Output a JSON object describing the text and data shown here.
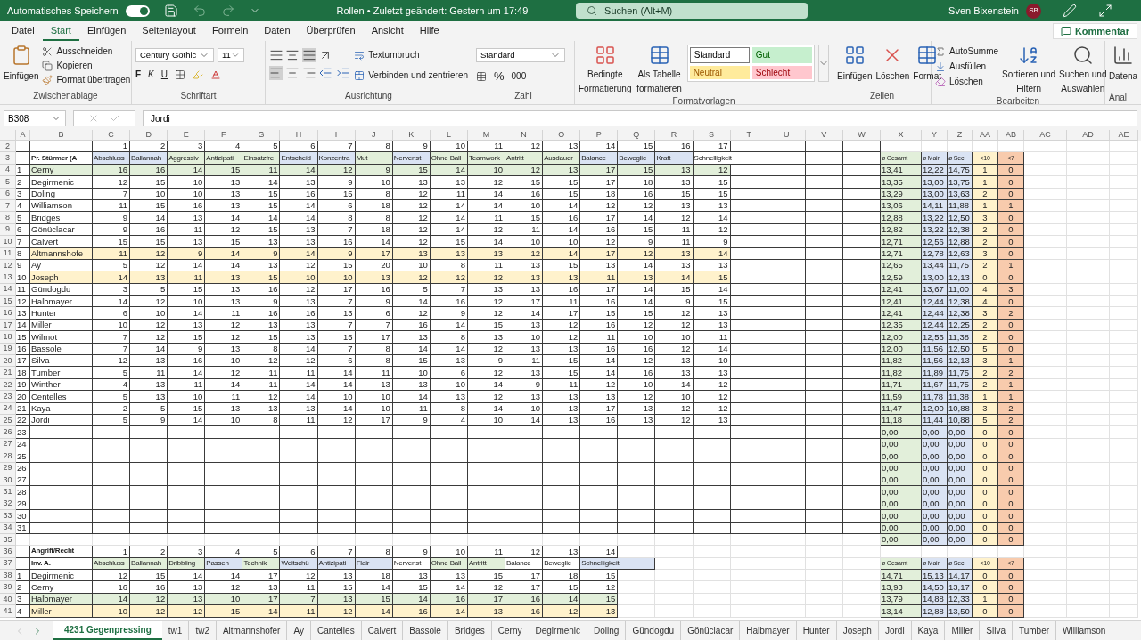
{
  "title_bar": {
    "autosave_label": "Automatisches Speichern",
    "autosave_on": true,
    "document_title": "Rollen • Zuletzt geändert: Gestern um 17:49",
    "search_placeholder": "Suchen (Alt+M)",
    "user_name": "Sven Bixenstein",
    "user_initials": "SB"
  },
  "ribbon_tabs": [
    {
      "label": "Datei",
      "selected": false
    },
    {
      "label": "Start",
      "selected": true
    },
    {
      "label": "Einfügen",
      "selected": false
    },
    {
      "label": "Seitenlayout",
      "selected": false
    },
    {
      "label": "Formeln",
      "selected": false
    },
    {
      "label": "Daten",
      "selected": false
    },
    {
      "label": "Überprüfen",
      "selected": false
    },
    {
      "label": "Ansicht",
      "selected": false
    },
    {
      "label": "Hilfe",
      "selected": false
    }
  ],
  "comment_button": "Kommentar",
  "ribbon": {
    "clipboard": {
      "paste": "Einfügen",
      "cut": "Ausschneiden",
      "copy": "Kopieren",
      "format_painter": "Format übertragen",
      "label": "Zwischenablage"
    },
    "font": {
      "name": "Century Gothic",
      "size": "11",
      "bold": "F",
      "italic": "K",
      "underline": "U",
      "label": "Schriftart"
    },
    "alignment": {
      "wrap": "Textumbruch",
      "merge": "Verbinden und zentrieren",
      "label": "Ausrichtung"
    },
    "number": {
      "format": "Standard",
      "percent": "%",
      "thousands": "000",
      "label": "Zahl"
    },
    "styles": {
      "conditional": [
        "Bedingte",
        "Formatierung"
      ],
      "as_table": [
        "Als Tabelle",
        "formatieren"
      ],
      "cell_styles": [
        {
          "label": "Standard",
          "kind": "standard"
        },
        {
          "label": "Gut",
          "kind": "good"
        },
        {
          "label": "Neutral",
          "kind": "neutral"
        },
        {
          "label": "Schlecht",
          "kind": "bad"
        }
      ],
      "label": "Formatvorlagen"
    },
    "cells": {
      "insert": "Einfügen",
      "delete": "Löschen",
      "format": "Format",
      "label": "Zellen"
    },
    "editing": {
      "autosum": "AutoSumme",
      "fill": "Ausfüllen",
      "clear": "Löschen",
      "sort": [
        "Sortieren und",
        "Filtern"
      ],
      "find": [
        "Suchen und",
        "Auswählen"
      ],
      "label": "Bearbeiten"
    },
    "analysis": {
      "button": "Datena",
      "label": "Anal"
    }
  },
  "formula_bar": {
    "name_box": "B308",
    "formula": "Jordi"
  },
  "sheet": {
    "columns": [
      "A",
      "B",
      "C",
      "D",
      "E",
      "F",
      "G",
      "H",
      "I",
      "J",
      "K",
      "L",
      "M",
      "N",
      "O",
      "P",
      "Q",
      "R",
      "S",
      "T",
      "U",
      "V",
      "W",
      "X",
      "Y",
      "Z",
      "AA",
      "AB",
      "AC",
      "AD",
      "AE"
    ],
    "rows": [
      {
        "row": "2",
        "kind": "numbers",
        "values": [
          "1",
          "2",
          "3",
          "4",
          "5",
          "6",
          "7",
          "8",
          "9",
          "10",
          "11",
          "12",
          "13",
          "14",
          "15",
          "16",
          "17"
        ]
      },
      {
        "row": "3",
        "kind": "header",
        "title": "Pr. Stürmer (A",
        "headers": [
          {
            "label": "Abschluss",
            "color": "#dae3f3"
          },
          {
            "label": "Ballannah",
            "color": "#dae3f3"
          },
          {
            "label": "Aggressiv",
            "color": "#e2efda"
          },
          {
            "label": "Antizipati",
            "color": "#e2efda"
          },
          {
            "label": "Einsatzfre",
            "color": "#e2efda"
          },
          {
            "label": "Entscheid",
            "color": "#dae3f3"
          },
          {
            "label": "Konzentra",
            "color": "#dae3f3"
          },
          {
            "label": "Mut",
            "color": "#e2efda"
          },
          {
            "label": "Nervenst",
            "color": "#dae3f3"
          },
          {
            "label": "Ohne Ball",
            "color": "#e2efda"
          },
          {
            "label": "Teamwork",
            "color": "#e2efda"
          },
          {
            "label": "Antritt",
            "color": "#e2efda"
          },
          {
            "label": "Ausdauer",
            "color": "#e2efda"
          },
          {
            "label": "Balance",
            "color": "#dae3f3"
          },
          {
            "label": "Beweglic",
            "color": "#dae3f3"
          },
          {
            "label": "Kraft",
            "color": "#dae3f3"
          },
          {
            "label": "Schnelligkeit",
            "color": "#ffffff"
          }
        ],
        "stat_headers": [
          "ø Gesamt",
          "ø Main",
          "ø Sec",
          "<10",
          "<7"
        ]
      },
      {
        "row": "4",
        "kind": "player",
        "index": "1",
        "name": "Cerny",
        "color": "#e2efda",
        "values": [
          "16",
          "16",
          "14",
          "15",
          "11",
          "14",
          "12",
          "9",
          "15",
          "14",
          "10",
          "12",
          "13",
          "17",
          "15",
          "13",
          "12"
        ],
        "stats": [
          "13,41",
          "12,22",
          "14,75",
          "1",
          "0"
        ]
      },
      {
        "row": "5",
        "kind": "player",
        "index": "2",
        "name": "Degirmenic",
        "color": "#ffffff",
        "values": [
          "12",
          "15",
          "10",
          "13",
          "14",
          "13",
          "9",
          "10",
          "13",
          "13",
          "12",
          "15",
          "15",
          "17",
          "18",
          "13",
          "15"
        ],
        "stats": [
          "13,35",
          "13,00",
          "13,75",
          "1",
          "0"
        ]
      },
      {
        "row": "6",
        "kind": "player",
        "index": "3",
        "name": "Doling",
        "color": "#ffffff",
        "values": [
          "7",
          "10",
          "10",
          "13",
          "15",
          "16",
          "15",
          "8",
          "12",
          "11",
          "14",
          "16",
          "15",
          "18",
          "16",
          "15",
          "15"
        ],
        "stats": [
          "13,29",
          "13,00",
          "13,63",
          "2",
          "0"
        ]
      },
      {
        "row": "7",
        "kind": "player",
        "index": "4",
        "name": "Williamson",
        "color": "#ffffff",
        "values": [
          "11",
          "15",
          "16",
          "13",
          "15",
          "14",
          "6",
          "18",
          "12",
          "14",
          "14",
          "10",
          "14",
          "12",
          "12",
          "13",
          "13"
        ],
        "stats": [
          "13,06",
          "14,11",
          "11,88",
          "1",
          "1"
        ]
      },
      {
        "row": "8",
        "kind": "player",
        "index": "5",
        "name": "Bridges",
        "color": "#ffffff",
        "values": [
          "9",
          "14",
          "13",
          "14",
          "14",
          "14",
          "8",
          "8",
          "12",
          "14",
          "11",
          "15",
          "16",
          "17",
          "14",
          "12",
          "14"
        ],
        "stats": [
          "12,88",
          "13,22",
          "12,50",
          "3",
          "0"
        ]
      },
      {
        "row": "9",
        "kind": "player",
        "index": "6",
        "name": "Gönüclacar",
        "color": "#ffffff",
        "values": [
          "9",
          "16",
          "11",
          "12",
          "15",
          "13",
          "7",
          "18",
          "12",
          "14",
          "12",
          "11",
          "14",
          "16",
          "15",
          "11",
          "12"
        ],
        "stats": [
          "12,82",
          "13,22",
          "12,38",
          "2",
          "0"
        ]
      },
      {
        "row": "10",
        "kind": "player",
        "index": "7",
        "name": "Calvert",
        "color": "#ffffff",
        "values": [
          "15",
          "15",
          "13",
          "15",
          "13",
          "13",
          "16",
          "14",
          "12",
          "15",
          "14",
          "10",
          "10",
          "12",
          "9",
          "11",
          "9"
        ],
        "stats": [
          "12,71",
          "12,56",
          "12,88",
          "2",
          "0"
        ]
      },
      {
        "row": "11",
        "kind": "player",
        "index": "8",
        "name": "Altmannshofe",
        "color": "#fff2cc",
        "values": [
          "11",
          "12",
          "9",
          "14",
          "9",
          "14",
          "9",
          "17",
          "13",
          "13",
          "13",
          "12",
          "14",
          "17",
          "12",
          "13",
          "14"
        ],
        "stats": [
          "12,71",
          "12,78",
          "12,63",
          "3",
          "0"
        ]
      },
      {
        "row": "12",
        "kind": "player",
        "index": "9",
        "name": "Ay",
        "color": "#ffffff",
        "values": [
          "5",
          "12",
          "14",
          "14",
          "13",
          "12",
          "15",
          "20",
          "10",
          "8",
          "11",
          "13",
          "15",
          "13",
          "14",
          "13",
          "13"
        ],
        "stats": [
          "12,65",
          "13,44",
          "11,75",
          "2",
          "1"
        ]
      },
      {
        "row": "13",
        "kind": "player",
        "index": "10",
        "name": "Joseph",
        "color": "#fff2cc",
        "values": [
          "14",
          "13",
          "11",
          "13",
          "15",
          "10",
          "10",
          "13",
          "12",
          "12",
          "12",
          "13",
          "13",
          "11",
          "13",
          "14",
          "15"
        ],
        "stats": [
          "12,59",
          "13,00",
          "12,13",
          "0",
          "0"
        ]
      },
      {
        "row": "14",
        "kind": "player",
        "index": "11",
        "name": "Gündogdu",
        "color": "#ffffff",
        "values": [
          "3",
          "5",
          "15",
          "13",
          "16",
          "12",
          "17",
          "16",
          "5",
          "7",
          "13",
          "13",
          "16",
          "17",
          "14",
          "15",
          "14"
        ],
        "stats": [
          "12,41",
          "13,67",
          "11,00",
          "4",
          "3"
        ]
      },
      {
        "row": "15",
        "kind": "player",
        "index": "12",
        "name": "Halbmayer",
        "color": "#ffffff",
        "values": [
          "14",
          "12",
          "10",
          "13",
          "9",
          "13",
          "7",
          "9",
          "14",
          "16",
          "12",
          "17",
          "11",
          "16",
          "14",
          "9",
          "15"
        ],
        "stats": [
          "12,41",
          "12,44",
          "12,38",
          "4",
          "0"
        ]
      },
      {
        "row": "16",
        "kind": "player",
        "index": "13",
        "name": "Hunter",
        "color": "#ffffff",
        "values": [
          "6",
          "10",
          "14",
          "11",
          "16",
          "16",
          "13",
          "6",
          "12",
          "9",
          "12",
          "14",
          "17",
          "15",
          "15",
          "12",
          "13"
        ],
        "stats": [
          "12,41",
          "12,44",
          "12,38",
          "3",
          "2"
        ]
      },
      {
        "row": "17",
        "kind": "player",
        "index": "14",
        "name": "Miller",
        "color": "#ffffff",
        "values": [
          "10",
          "12",
          "13",
          "12",
          "13",
          "13",
          "7",
          "7",
          "16",
          "14",
          "15",
          "13",
          "12",
          "16",
          "12",
          "12",
          "13"
        ],
        "stats": [
          "12,35",
          "12,44",
          "12,25",
          "2",
          "0"
        ]
      },
      {
        "row": "18",
        "kind": "player",
        "index": "15",
        "name": "Wilmot",
        "color": "#ffffff",
        "values": [
          "7",
          "12",
          "15",
          "12",
          "15",
          "13",
          "15",
          "17",
          "13",
          "8",
          "13",
          "10",
          "12",
          "11",
          "10",
          "10",
          "11"
        ],
        "stats": [
          "12,00",
          "12,56",
          "11,38",
          "2",
          "0"
        ]
      },
      {
        "row": "19",
        "kind": "player",
        "index": "16",
        "name": "Bassole",
        "color": "#ffffff",
        "values": [
          "7",
          "14",
          "9",
          "13",
          "8",
          "14",
          "7",
          "8",
          "14",
          "14",
          "12",
          "13",
          "13",
          "16",
          "16",
          "12",
          "14"
        ],
        "stats": [
          "12,00",
          "11,56",
          "12,50",
          "5",
          "0"
        ]
      },
      {
        "row": "20",
        "kind": "player",
        "index": "17",
        "name": "Silva",
        "color": "#ffffff",
        "values": [
          "12",
          "13",
          "16",
          "10",
          "12",
          "12",
          "6",
          "8",
          "15",
          "13",
          "9",
          "11",
          "15",
          "14",
          "12",
          "13",
          "10"
        ],
        "stats": [
          "11,82",
          "11,56",
          "12,13",
          "3",
          "1"
        ]
      },
      {
        "row": "21",
        "kind": "player",
        "index": "18",
        "name": "Tumber",
        "color": "#ffffff",
        "values": [
          "5",
          "11",
          "14",
          "12",
          "11",
          "11",
          "14",
          "11",
          "10",
          "6",
          "12",
          "13",
          "15",
          "14",
          "16",
          "13",
          "13"
        ],
        "stats": [
          "11,82",
          "11,89",
          "11,75",
          "2",
          "2"
        ]
      },
      {
        "row": "22",
        "kind": "player",
        "index": "19",
        "name": "Winther",
        "color": "#ffffff",
        "values": [
          "4",
          "13",
          "11",
          "14",
          "11",
          "14",
          "14",
          "13",
          "13",
          "10",
          "14",
          "9",
          "11",
          "12",
          "10",
          "14",
          "12"
        ],
        "stats": [
          "11,71",
          "11,67",
          "11,75",
          "2",
          "1"
        ]
      },
      {
        "row": "23",
        "kind": "player",
        "index": "20",
        "name": "Centelles",
        "color": "#ffffff",
        "values": [
          "5",
          "13",
          "10",
          "11",
          "12",
          "14",
          "10",
          "10",
          "14",
          "13",
          "12",
          "13",
          "13",
          "13",
          "12",
          "10",
          "12"
        ],
        "stats": [
          "11,59",
          "11,78",
          "11,38",
          "1",
          "1"
        ]
      },
      {
        "row": "24",
        "kind": "player",
        "index": "21",
        "name": "Kaya",
        "color": "#ffffff",
        "values": [
          "2",
          "5",
          "15",
          "13",
          "13",
          "13",
          "14",
          "10",
          "11",
          "8",
          "14",
          "10",
          "13",
          "17",
          "13",
          "12",
          "12"
        ],
        "stats": [
          "11,47",
          "12,00",
          "10,88",
          "3",
          "2"
        ]
      },
      {
        "row": "25",
        "kind": "player",
        "index": "22",
        "name": "Jordi",
        "color": "#ffffff",
        "values": [
          "5",
          "9",
          "14",
          "10",
          "8",
          "11",
          "12",
          "17",
          "9",
          "4",
          "10",
          "14",
          "13",
          "16",
          "13",
          "12",
          "13"
        ],
        "stats": [
          "11,18",
          "11,44",
          "10,88",
          "5",
          "2"
        ]
      },
      {
        "row": "26",
        "kind": "empty",
        "index": "23",
        "stats": [
          "0,00",
          "0,00",
          "0,00",
          "0",
          "0"
        ]
      },
      {
        "row": "27",
        "kind": "empty",
        "index": "24",
        "stats": [
          "0,00",
          "0,00",
          "0,00",
          "0",
          "0"
        ]
      },
      {
        "row": "28",
        "kind": "empty",
        "index": "25",
        "stats": [
          "0,00",
          "0,00",
          "0,00",
          "0",
          "0"
        ]
      },
      {
        "row": "29",
        "kind": "empty",
        "index": "26",
        "stats": [
          "0,00",
          "0,00",
          "0,00",
          "0",
          "0"
        ]
      },
      {
        "row": "30",
        "kind": "empty",
        "index": "27",
        "stats": [
          "0,00",
          "0,00",
          "0,00",
          "0",
          "0"
        ]
      },
      {
        "row": "31",
        "kind": "empty",
        "index": "28",
        "stats": [
          "0,00",
          "0,00",
          "0,00",
          "0",
          "0"
        ]
      },
      {
        "row": "32",
        "kind": "empty",
        "index": "29",
        "stats": [
          "0,00",
          "0,00",
          "0,00",
          "0",
          "0"
        ]
      },
      {
        "row": "33",
        "kind": "empty",
        "index": "30",
        "stats": [
          "0,00",
          "0,00",
          "0,00",
          "0",
          "0"
        ]
      },
      {
        "row": "34",
        "kind": "empty",
        "index": "31",
        "stats": [
          "0,00",
          "0,00",
          "0,00",
          "0",
          "0"
        ]
      },
      {
        "row": "35",
        "kind": "stats_only",
        "stats": [
          "0,00",
          "0,00",
          "0,00",
          "0",
          "0"
        ]
      },
      {
        "row": "36",
        "kind": "numbers",
        "title": "Angriff/Recht",
        "values": [
          "1",
          "2",
          "3",
          "4",
          "5",
          "6",
          "7",
          "8",
          "9",
          "10",
          "11",
          "12",
          "13",
          "14"
        ]
      },
      {
        "row": "37",
        "kind": "header",
        "title": "Inv. A.",
        "headers": [
          {
            "label": "Abschluss",
            "color": "#e2efda"
          },
          {
            "label": "Ballannah",
            "color": "#e2efda"
          },
          {
            "label": "Dribbling",
            "color": "#e2efda"
          },
          {
            "label": "Passen",
            "color": "#dae3f3"
          },
          {
            "label": "Technik",
            "color": "#e2efda"
          },
          {
            "label": "Weitschü",
            "color": "#dae3f3"
          },
          {
            "label": "Antizipati",
            "color": "#dae3f3"
          },
          {
            "label": "Flair",
            "color": "#dae3f3"
          },
          {
            "label": "Nervenst",
            "color": "#ffffff"
          },
          {
            "label": "Ohne Ball",
            "color": "#e2efda"
          },
          {
            "label": "Antritt",
            "color": "#e2efda"
          },
          {
            "label": "Balance",
            "color": "#ffffff"
          },
          {
            "label": "Beweglic",
            "color": "#ffffff"
          },
          {
            "label": "Schnelligkeit",
            "color": "#dae3f3"
          }
        ],
        "stat_headers": [
          "ø Gesamt",
          "ø Main",
          "ø Sec",
          "<10",
          "<7"
        ]
      },
      {
        "row": "38",
        "kind": "player",
        "index": "1",
        "name": "Degirmenic",
        "color": "#ffffff",
        "values": [
          "12",
          "15",
          "14",
          "14",
          "17",
          "12",
          "13",
          "18",
          "13",
          "13",
          "15",
          "17",
          "18",
          "15"
        ],
        "stats": [
          "14,71",
          "15,13",
          "14,17",
          "0",
          "0"
        ]
      },
      {
        "row": "39",
        "kind": "player",
        "index": "2",
        "name": "Cerny",
        "color": "#ffffff",
        "values": [
          "16",
          "16",
          "13",
          "12",
          "13",
          "11",
          "15",
          "14",
          "15",
          "14",
          "12",
          "17",
          "15",
          "12"
        ],
        "stats": [
          "13,93",
          "14,50",
          "13,17",
          "0",
          "0"
        ]
      },
      {
        "row": "40",
        "kind": "player",
        "index": "3",
        "name": "Halbmayer",
        "color": "#e2efda",
        "values": [
          "14",
          "12",
          "13",
          "10",
          "17",
          "7",
          "13",
          "15",
          "14",
          "16",
          "17",
          "16",
          "14",
          "15"
        ],
        "stats": [
          "13,79",
          "14,88",
          "12,33",
          "1",
          "0"
        ]
      },
      {
        "row": "41",
        "kind": "player",
        "index": "4",
        "name": "Miller",
        "color": "#fff2cc",
        "values": [
          "10",
          "12",
          "12",
          "15",
          "14",
          "11",
          "12",
          "14",
          "16",
          "14",
          "13",
          "16",
          "12",
          "13"
        ],
        "stats": [
          "13,14",
          "12,88",
          "13,50",
          "0",
          "0"
        ]
      }
    ]
  },
  "sheet_tabs": [
    {
      "label": "4231 Gegenpressing",
      "selected": true
    },
    {
      "label": "tw1",
      "selected": false
    },
    {
      "label": "tw2",
      "selected": false
    },
    {
      "label": "Altmannshofer",
      "selected": false
    },
    {
      "label": "Ay",
      "selected": false
    },
    {
      "label": "Cantelles",
      "selected": false
    },
    {
      "label": "Calvert",
      "selected": false
    },
    {
      "label": "Bassole",
      "selected": false
    },
    {
      "label": "Bridges",
      "selected": false
    },
    {
      "label": "Cerny",
      "selected": false
    },
    {
      "label": "Degirmenic",
      "selected": false
    },
    {
      "label": "Doling",
      "selected": false
    },
    {
      "label": "Gündogdu",
      "selected": false
    },
    {
      "label": "Gönüclacar",
      "selected": false
    },
    {
      "label": "Halbmayer",
      "selected": false
    },
    {
      "label": "Hunter",
      "selected": false
    },
    {
      "label": "Joseph",
      "selected": false
    },
    {
      "label": "Jordi",
      "selected": false
    },
    {
      "label": "Kaya",
      "selected": false
    },
    {
      "label": "Miller",
      "selected": false
    },
    {
      "label": "Silva",
      "selected": false
    },
    {
      "label": "Tumber",
      "selected": false
    },
    {
      "label": "Williamson",
      "selected": false
    }
  ]
}
